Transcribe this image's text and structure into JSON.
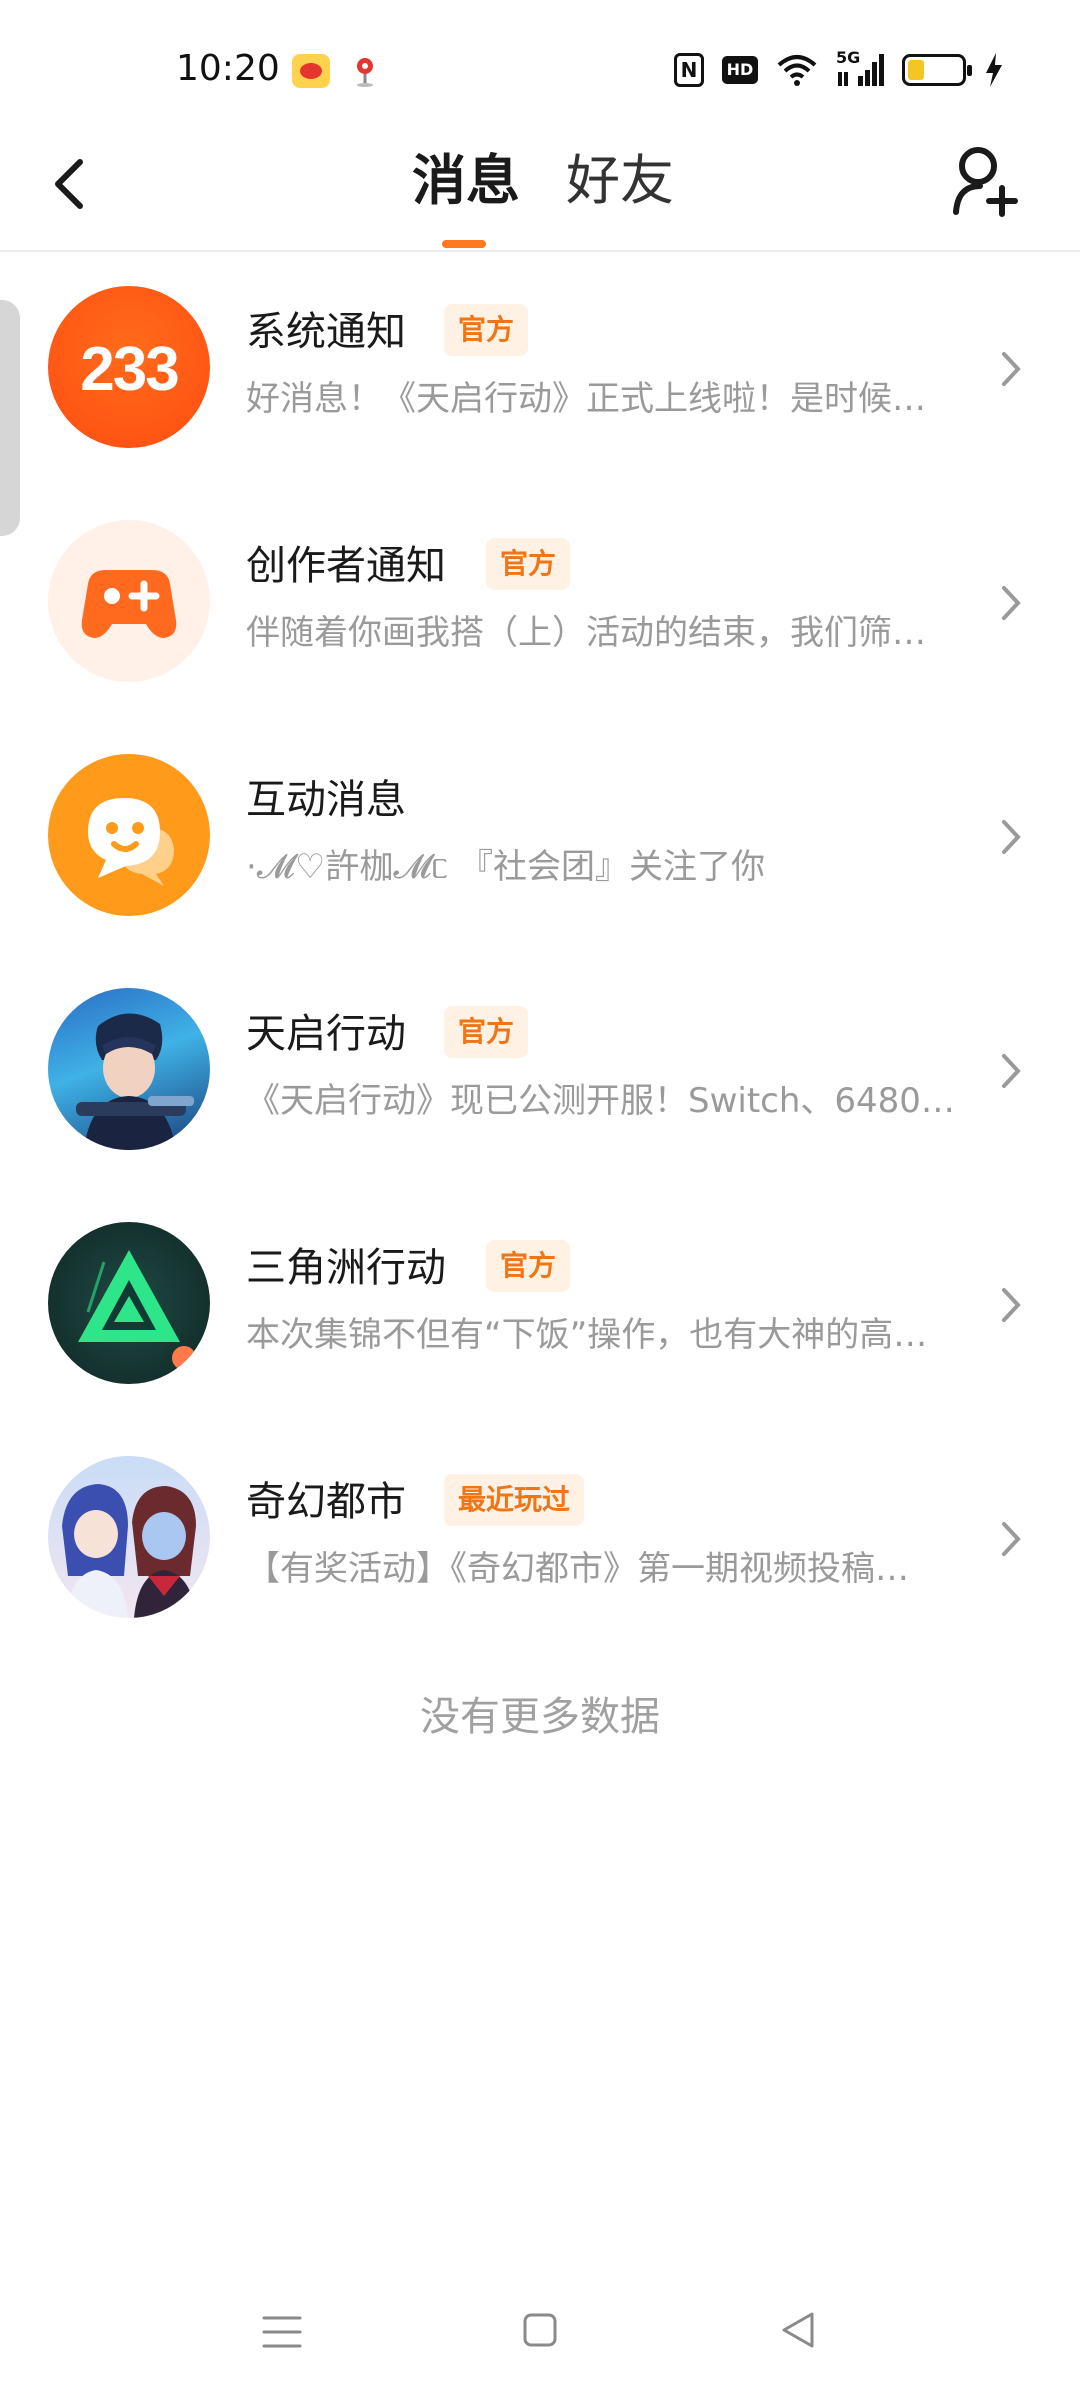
{
  "status_bar": {
    "time": "10:20",
    "network": "5G",
    "icons": [
      "weibo-icon",
      "location-pin-icon",
      "nfc-icon",
      "hd-icon",
      "wifi-icon",
      "signal-icon",
      "battery-icon",
      "charging-icon"
    ],
    "hd_label": "HD",
    "nfc_label": "N"
  },
  "header": {
    "tabs": [
      {
        "label": "消息",
        "active": true
      },
      {
        "label": "好友",
        "active": false
      }
    ],
    "accent_color": "#ff7a1f"
  },
  "messages": [
    {
      "title": "系统通知",
      "badge": "官方",
      "preview": "好消息！《天启行动》正式上线啦！是时候…",
      "avatar": "233-logo-icon",
      "avatar_text": "233"
    },
    {
      "title": "创作者通知",
      "badge": "官方",
      "preview": "伴随着你画我搭（上）活动的结束，我们筛…",
      "avatar": "gamepad-icon"
    },
    {
      "title": "互动消息",
      "badge": "",
      "preview": "·𝓜♡許枷𝓜ᥴ 『社会团』关注了你",
      "avatar": "chat-bubble-icon"
    },
    {
      "title": "天启行动",
      "badge": "官方",
      "preview": "《天启行动》现已公测开服！Switch、6480…",
      "avatar": "game-avatar-tianqi"
    },
    {
      "title": "三角洲行动",
      "badge": "官方",
      "preview": "本次集锦不但有“下饭”操作，也有大神的高…",
      "avatar": "game-avatar-delta"
    },
    {
      "title": "奇幻都市",
      "badge": "最近玩过",
      "preview": "【有奖活动】《奇幻都市》第一期视频投稿…",
      "avatar": "game-avatar-qihuan"
    }
  ],
  "footer": {
    "no_more": "没有更多数据"
  }
}
